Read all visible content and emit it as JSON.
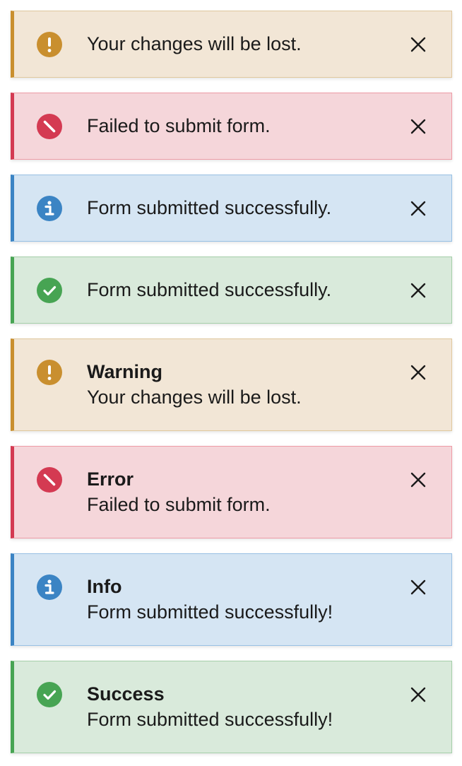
{
  "colors": {
    "warning_accent": "#c98f2f",
    "error_accent": "#d43a52",
    "info_accent": "#3b84c4",
    "success_accent": "#47a453"
  },
  "toasts": [
    {
      "variant": "warning",
      "icon": "exclamation-icon",
      "title": "",
      "message": "Your changes will be lost."
    },
    {
      "variant": "error",
      "icon": "ban-icon",
      "title": "",
      "message": "Failed to submit form."
    },
    {
      "variant": "info",
      "icon": "info-icon",
      "title": "",
      "message": "Form submitted successfully."
    },
    {
      "variant": "success",
      "icon": "checkmark-icon",
      "title": "",
      "message": "Form submitted successfully."
    },
    {
      "variant": "warning",
      "icon": "exclamation-icon",
      "title": "Warning",
      "message": "Your changes will be lost."
    },
    {
      "variant": "error",
      "icon": "ban-icon",
      "title": "Error",
      "message": "Failed to submit form."
    },
    {
      "variant": "info",
      "icon": "info-icon",
      "title": "Info",
      "message": "Form submitted successfully!"
    },
    {
      "variant": "success",
      "icon": "checkmark-icon",
      "title": "Success",
      "message": "Form submitted successfully!"
    }
  ],
  "close_icon": "close-icon"
}
